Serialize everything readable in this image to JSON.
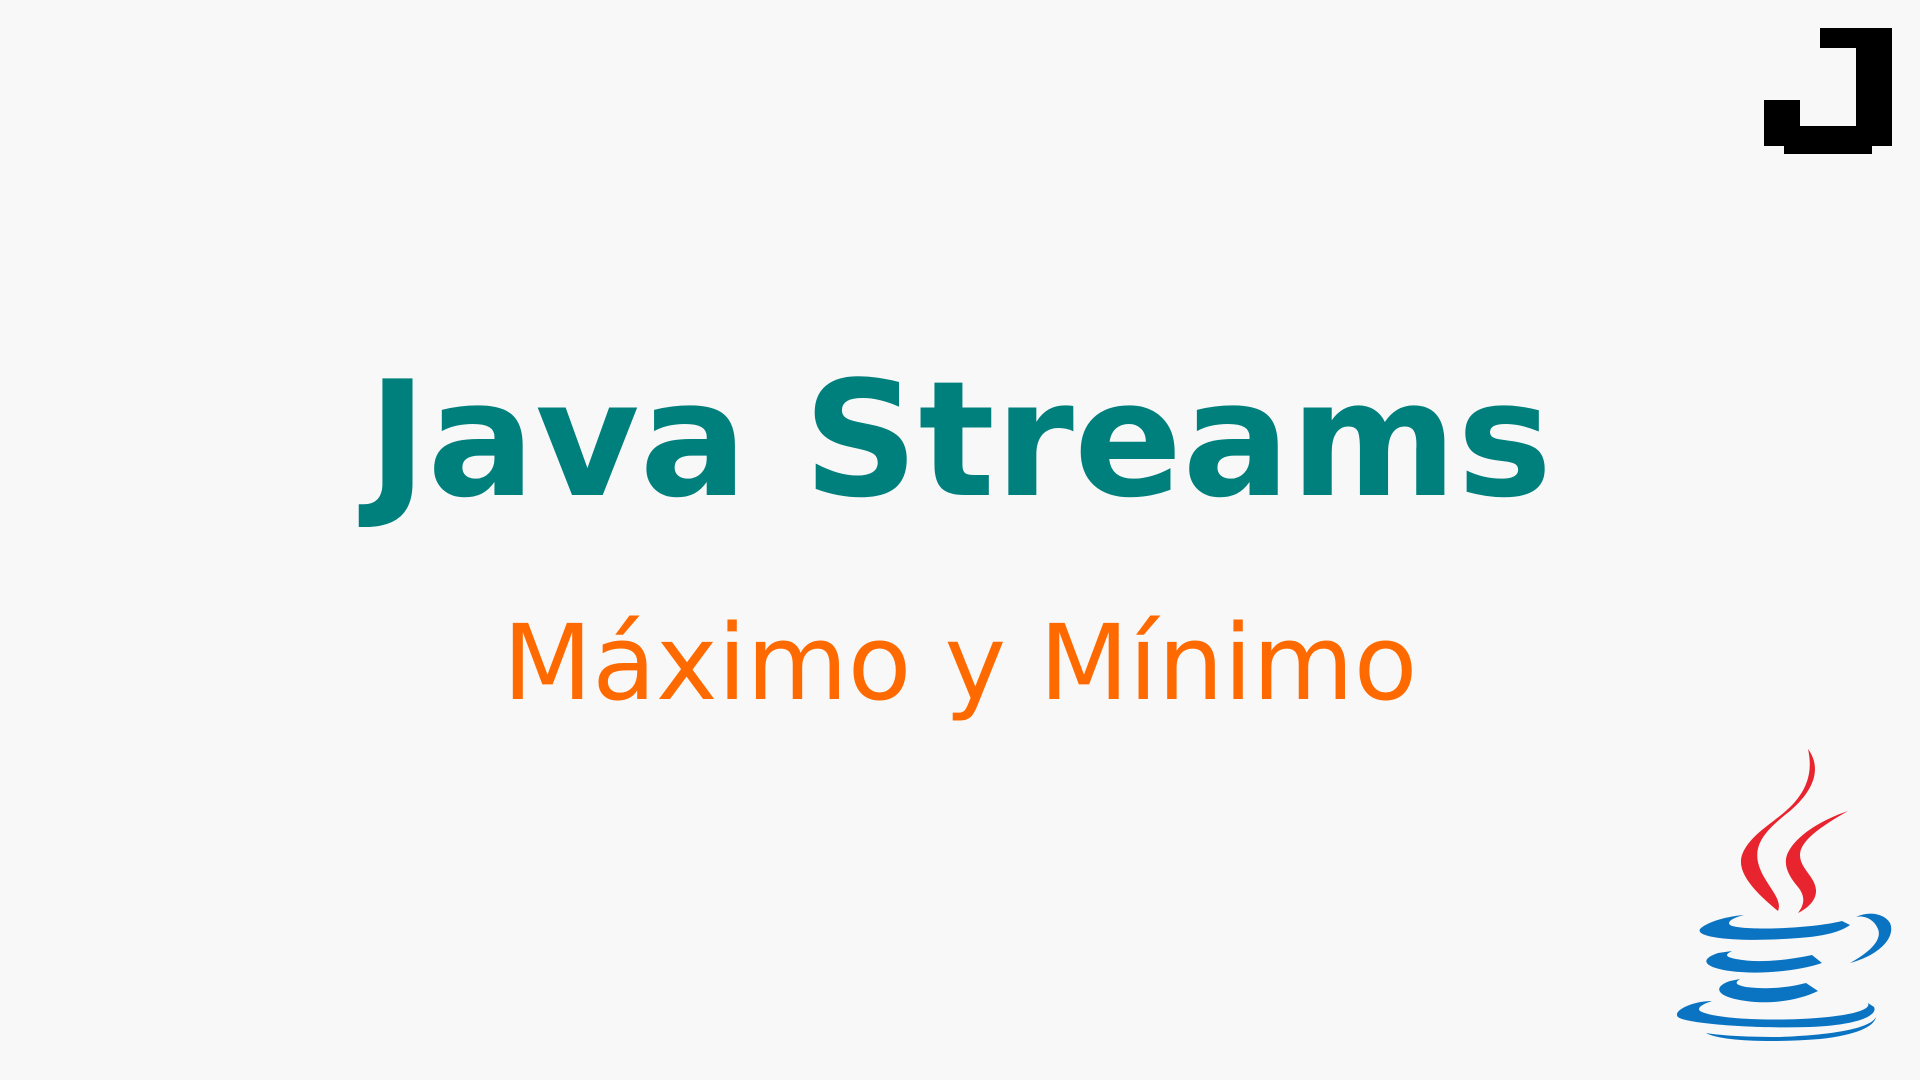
{
  "slide": {
    "title": "Java Streams",
    "subtitle": "Máximo y Mínimo"
  },
  "icons": {
    "corner": "j-pixel-logo-icon",
    "brand": "java-coffee-cup-logo-icon"
  },
  "colors": {
    "background": "#f8f8f8",
    "title": "#00807d",
    "subtitle": "#ff6a00",
    "java_flame": "#e8242e",
    "java_cup": "#0b74c2",
    "corner_logo": "#000000"
  }
}
